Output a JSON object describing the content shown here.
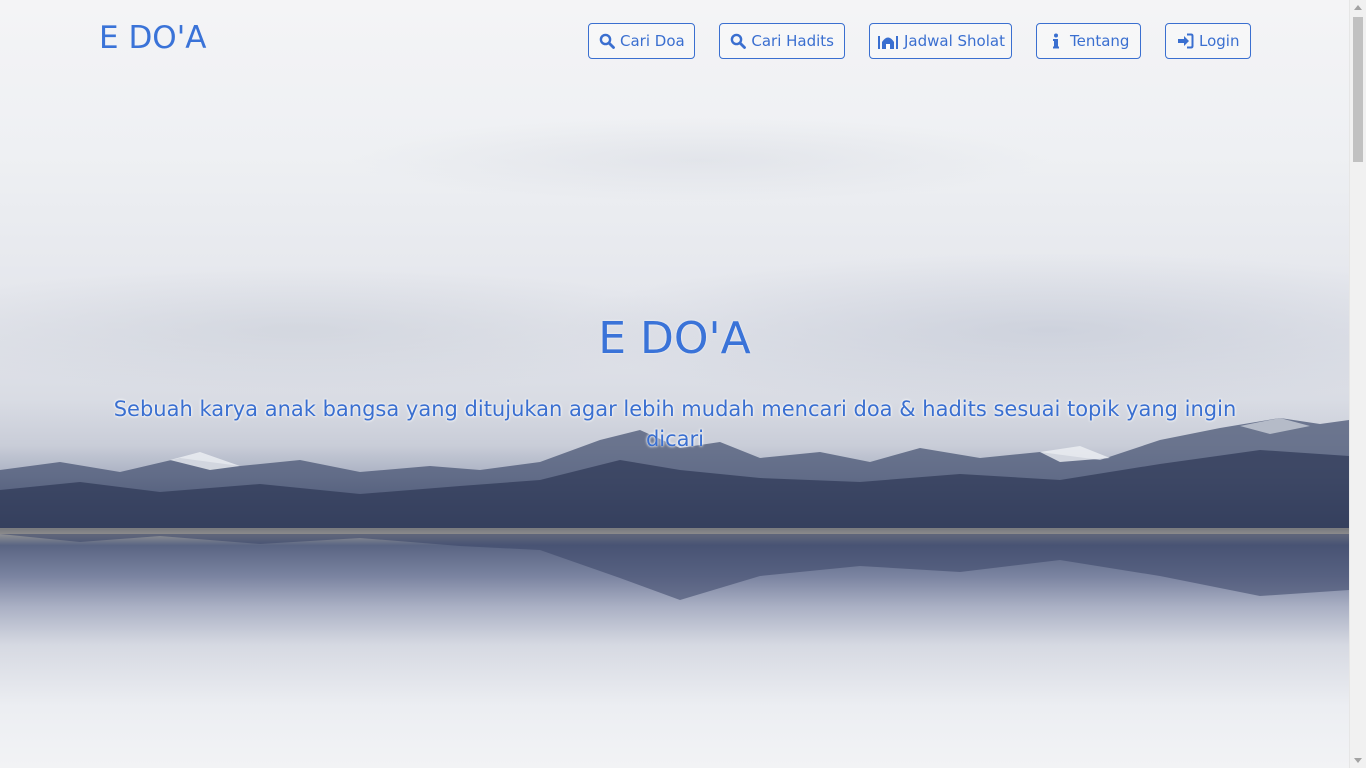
{
  "navbar": {
    "brand": "E DO'A",
    "buttons": [
      {
        "label": "Cari Doa",
        "icon": "search-icon"
      },
      {
        "label": "Cari Hadits",
        "icon": "search-icon"
      },
      {
        "label": "Jadwal Sholat",
        "icon": "mosque-icon"
      },
      {
        "label": "Tentang",
        "icon": "info-icon"
      },
      {
        "label": "Login",
        "icon": "sign-in-icon"
      }
    ]
  },
  "hero": {
    "title": "E DO'A",
    "subtitle": "Sebuah karya anak bangsa yang ditujukan agar lebih mudah mencari doa & hadits sesuai topik yang ingin dicari"
  },
  "colors": {
    "accent": "#3a73d8",
    "button_border": "#3a6fd0"
  }
}
